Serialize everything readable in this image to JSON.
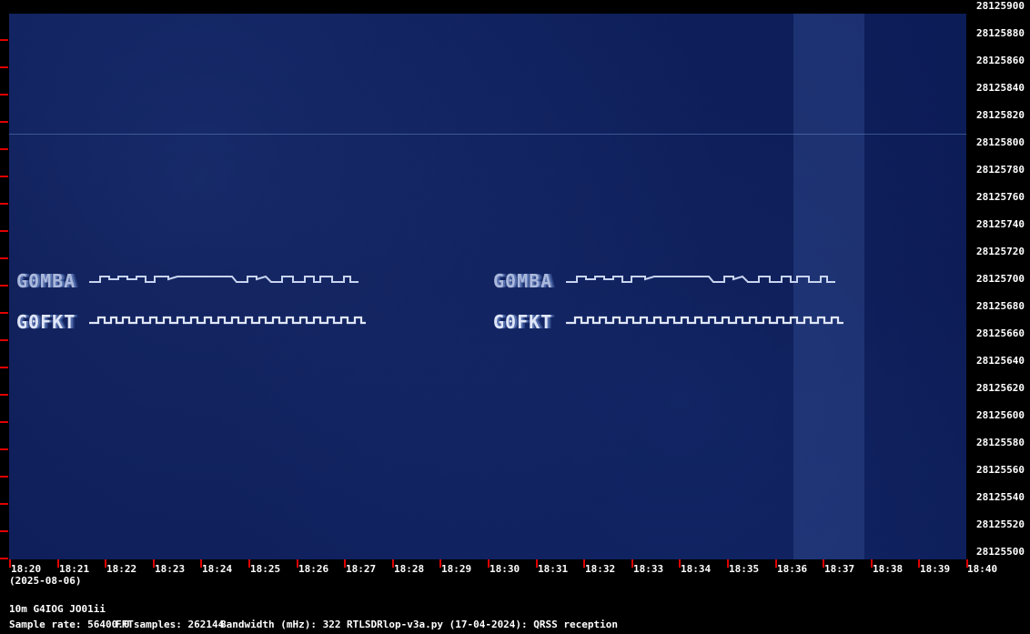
{
  "colors": {
    "background": "#000000",
    "spectrogram_bg": "#0b1a52",
    "tick": "#e00000",
    "text": "#ffffff",
    "signal": "#c8d4f0"
  },
  "date_label": "(2025-08-06)",
  "station_label": "10m G4IOG JO01ii",
  "footer": {
    "sample_rate": "Sample rate: 56400.0",
    "fft_samples": "FFTsamples: 262144",
    "bandwidth": "Bandwidth (mHz): 322",
    "software": "RTLSDRlop-v3a.py (17-04-2024): QRSS reception"
  },
  "callsigns": {
    "first_pass": {
      "upper": "G0MBA",
      "lower": "G0FKT"
    },
    "second_pass": {
      "upper": "G0MBA",
      "lower": "G0FKT"
    }
  },
  "frequency_labels": [
    "28125900",
    "28125880",
    "28125860",
    "28125840",
    "28125820",
    "28125800",
    "28125780",
    "28125760",
    "28125740",
    "28125720",
    "28125700",
    "28125680",
    "28125660",
    "28125640",
    "28125620",
    "28125600",
    "28125580",
    "28125560",
    "28125540",
    "28125520",
    "28125500"
  ],
  "time_labels": [
    "18:20",
    "18:21",
    "18:22",
    "18:23",
    "18:24",
    "18:25",
    "18:26",
    "18:27",
    "18:28",
    "18:29",
    "18:30",
    "18:31",
    "18:32",
    "18:33",
    "18:34",
    "18:35",
    "18:36",
    "18:37",
    "18:38",
    "18:39",
    "18:40"
  ],
  "chart_data": {
    "type": "heatmap",
    "xlabel": "",
    "ylabel": "",
    "x_ticks": [
      "18:20",
      "18:21",
      "18:22",
      "18:23",
      "18:24",
      "18:25",
      "18:26",
      "18:27",
      "18:28",
      "18:29",
      "18:30",
      "18:31",
      "18:32",
      "18:33",
      "18:34",
      "18:35",
      "18:36",
      "18:37",
      "18:38",
      "18:39",
      "18:40"
    ],
    "y_ticks": [
      28125900,
      28125880,
      28125860,
      28125840,
      28125820,
      28125800,
      28125780,
      28125760,
      28125740,
      28125720,
      28125700,
      28125680,
      28125660,
      28125640,
      28125620,
      28125600,
      28125580,
      28125560,
      28125540,
      28125520,
      28125500
    ],
    "ylim": [
      28125500,
      28125900
    ],
    "signals": [
      {
        "label": "G0MBA",
        "frequency": 28125697,
        "start": "18:20",
        "end": "18:27"
      },
      {
        "label": "G0FKT",
        "frequency": 28125667,
        "start": "18:20",
        "end": "18:27"
      },
      {
        "label": "G0MBA",
        "frequency": 28125697,
        "start": "18:30",
        "end": "18:37"
      },
      {
        "label": "G0FKT",
        "frequency": 28125667,
        "start": "18:30",
        "end": "18:37"
      }
    ]
  }
}
